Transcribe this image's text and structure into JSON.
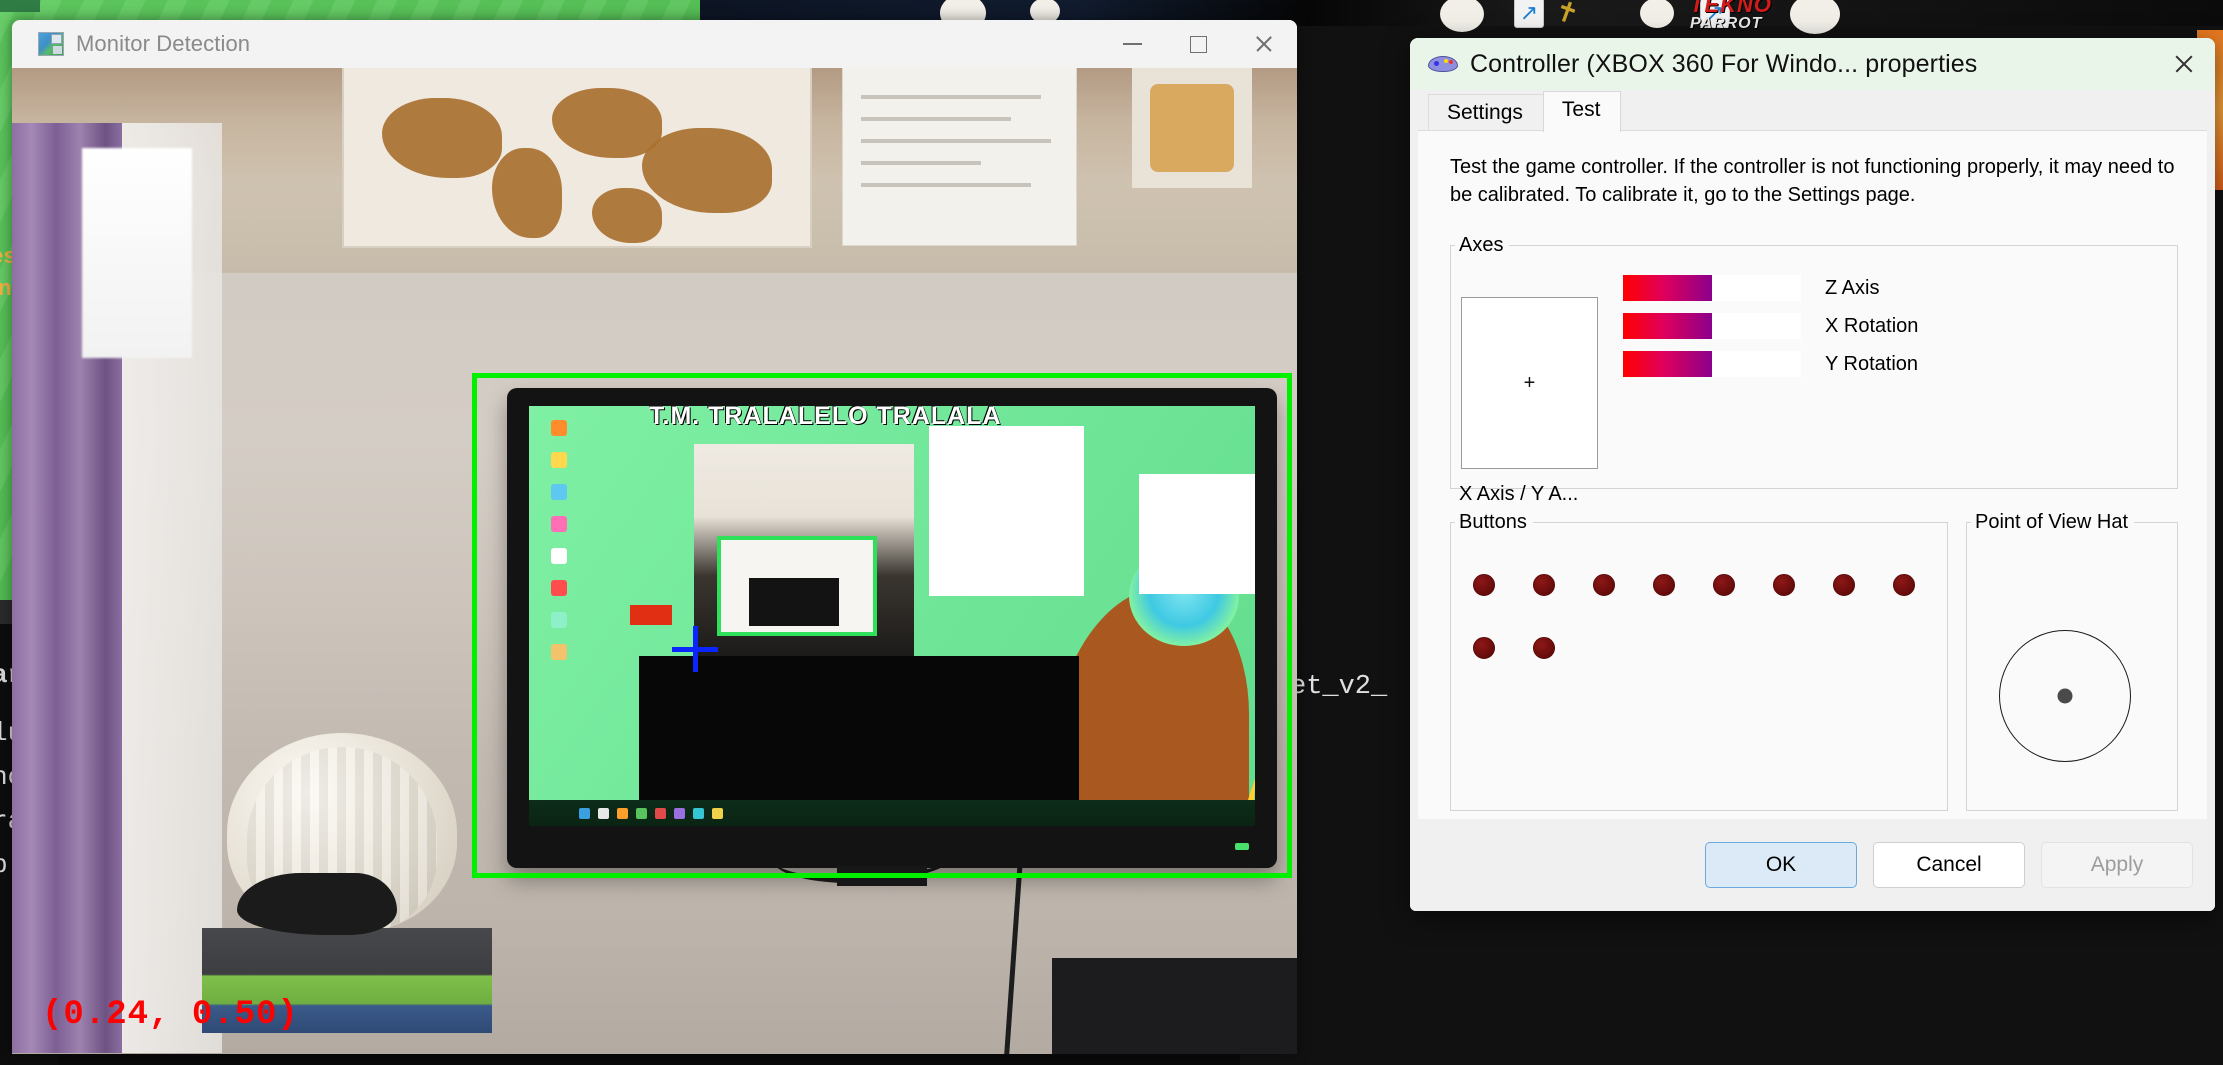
{
  "background": {
    "left_overlay_lines": [
      "res",
      "Tin"
    ],
    "left_terminal_lines": [
      "ar",
      "lu",
      "no",
      "ra",
      "b"
    ],
    "right_label": "et_v2_",
    "tekno_logo": {
      "line1": "TEKNO",
      "line2": "PARROT"
    },
    "shortcut_icon": "shortcut-arrow-icon"
  },
  "monitor_window": {
    "title": "Monitor Detection",
    "icon": "monitor-detection-icon",
    "controls": {
      "minimize": "minimize-icon",
      "maximize": "maximize-icon",
      "close": "close-icon"
    },
    "coordinate_readout": "(0.24, 0.50)",
    "tv_overlay_title": "T.M. TRALALELO TRALALA",
    "detection_box": "green-detection-rectangle",
    "crosshair": "blue-crosshair-marker"
  },
  "controller_dialog": {
    "title": "Controller (XBOX 360 For Windo... properties",
    "icon": "gamepad-icon",
    "close_label": "close-icon",
    "tabs": [
      {
        "label": "Settings",
        "active": false
      },
      {
        "label": "Test",
        "active": true
      }
    ],
    "description": "Test the game controller.  If the controller is not functioning properly, it may need to be calibrated.  To calibrate it, go to the Settings page.",
    "axes": {
      "legend": "Axes",
      "pad_label": "X Axis / Y A...",
      "pad_marker": "+",
      "sliders": [
        {
          "label": "Z Axis",
          "value_pct": 50
        },
        {
          "label": "X Rotation",
          "value_pct": 50
        },
        {
          "label": "Y Rotation",
          "value_pct": 50
        }
      ],
      "fill_start_color": "#ff0000",
      "fill_end_color": "#8b008b"
    },
    "buttons_group": {
      "legend": "Buttons",
      "items": [
        "1",
        "2",
        "3",
        "4",
        "5",
        "6",
        "7",
        "8",
        "9",
        "10"
      ],
      "dot_color": "#6d0d0d"
    },
    "pov_group": {
      "legend": "Point of View Hat",
      "indicator": "pov-center-dot"
    },
    "footer": {
      "ok": "OK",
      "cancel": "Cancel",
      "apply": "Apply"
    }
  }
}
